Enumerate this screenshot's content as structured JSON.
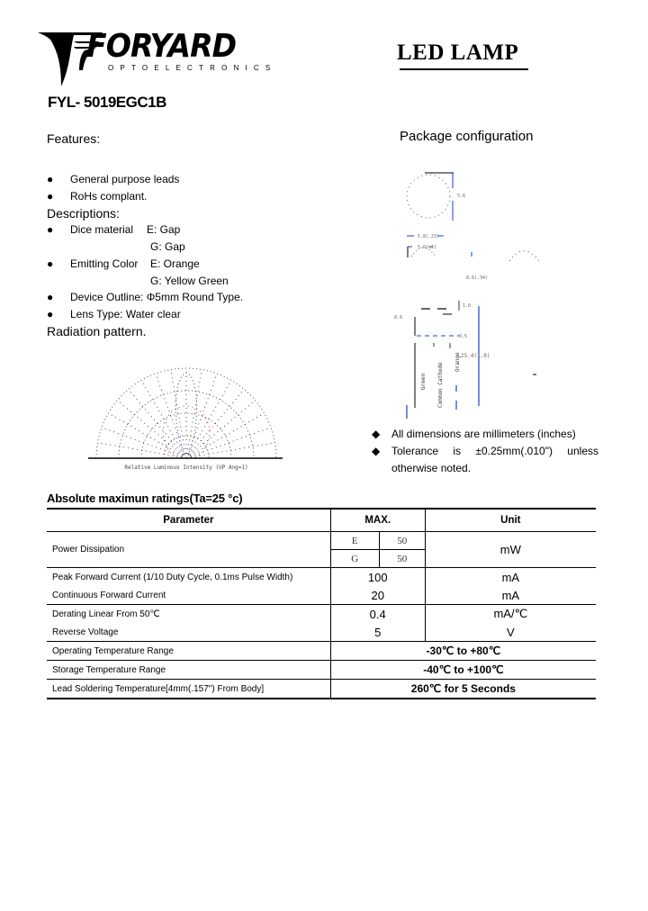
{
  "header": {
    "brand": "FORYARD",
    "brand_subtitle": "OPTOELECTRONICS",
    "doc_title": "LED LAMP",
    "part_number": "FYL- 5019EGC1B"
  },
  "features": {
    "heading": "Features:",
    "items": [
      "General purpose leads",
      "RoHs complant."
    ]
  },
  "descriptions": {
    "heading": "Descriptions:",
    "items": [
      {
        "label": "Dice material",
        "values": [
          "E: Gap",
          "G: Gap"
        ]
      },
      {
        "label": "Emitting Color",
        "values": [
          "E: Orange",
          "G: Yellow Green"
        ]
      },
      {
        "label": "Device Outline: Φ5mm Round Type.",
        "values": []
      },
      {
        "label": "Lens Type: Water clear",
        "values": []
      }
    ]
  },
  "radiation": {
    "heading": "Radiation pattern.",
    "axis_label": "Relative Luminous Intensity (UP Ang=1)",
    "series_colors": {
      "green": "#1a3fcc",
      "orange": "#cc2222",
      "grid": "#222222"
    }
  },
  "package": {
    "heading": "Package configuration",
    "lead_labels": [
      "Green",
      "Common Cathode",
      "Orange"
    ],
    "dimension_label": "25.4(1.0)",
    "notes": [
      "All dimensions are millimeters (inches)",
      "Tolerance is ±0.25mm(.010\") unless otherwise noted."
    ]
  },
  "ratings": {
    "title": "Absolute maximun ratings(Ta=25 °c)",
    "headers": {
      "parameter": "Parameter",
      "max": "MAX.",
      "unit": "Unit"
    },
    "power": {
      "label": "Power Dissipation",
      "rows": [
        {
          "chip": "E",
          "value": "50"
        },
        {
          "chip": "G",
          "value": "50"
        }
      ],
      "unit": "mW"
    },
    "rows": [
      {
        "parameter": "Peak Forward Current (1/10 Duty Cycle, 0.1ms Pulse Width)",
        "max": "100",
        "unit": "mA"
      },
      {
        "parameter": "Continuous Forward Current",
        "max": "20",
        "unit": "mA"
      },
      {
        "parameter": "Derating Linear From 50℃",
        "max": "0.4",
        "unit": "mA/℃"
      },
      {
        "parameter": "Reverse Voltage",
        "max": "5",
        "unit": "V"
      }
    ],
    "wide_rows": [
      {
        "parameter": "Operating Temperature Range",
        "value": "-30℃ to +80℃"
      },
      {
        "parameter": "Storage Temperature Range",
        "value": "-40℃ to +100℃"
      },
      {
        "parameter": "Lead Soldering Temperature[4mm(.157\") From Body]",
        "value": "260℃ for 5 Seconds"
      }
    ]
  }
}
